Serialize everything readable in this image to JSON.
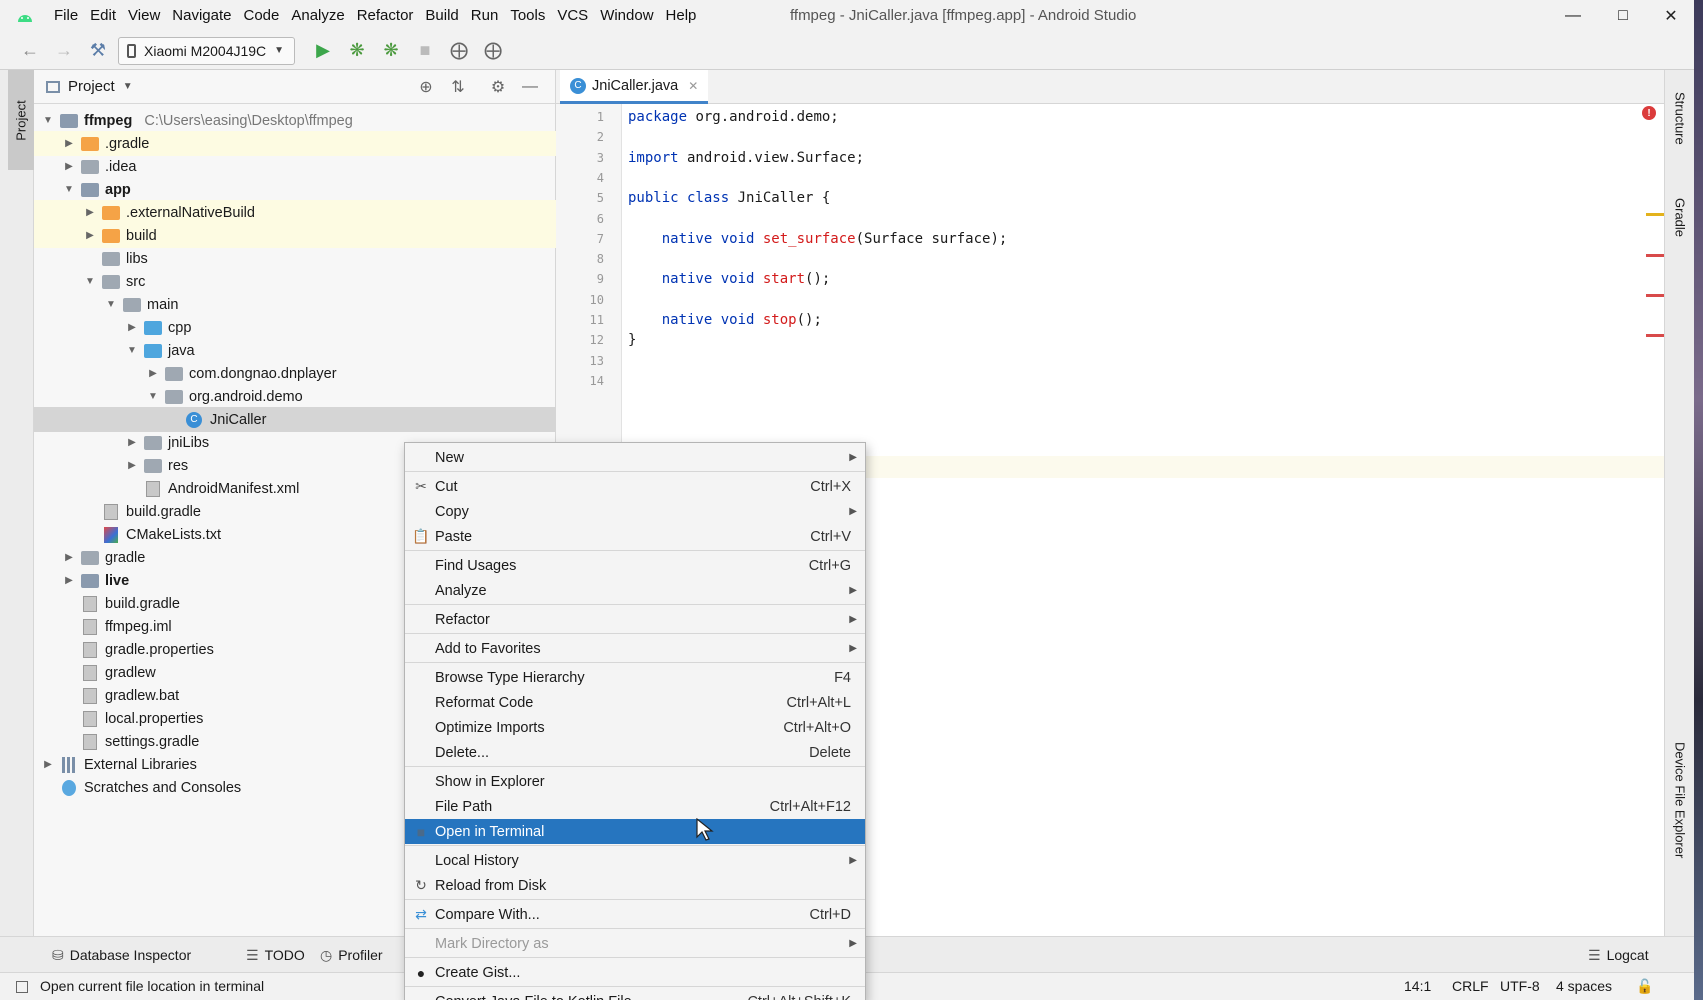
{
  "title_bar": {
    "menus": [
      "File",
      "Edit",
      "View",
      "Navigate",
      "Code",
      "Analyze",
      "Refactor",
      "Build",
      "Run",
      "Tools",
      "VCS",
      "Window",
      "Help"
    ],
    "window_title": "ffmpeg - JniCaller.java [ffmpeg.app] - Android Studio"
  },
  "toolbar": {
    "device": "Xiaomi M2004J19C"
  },
  "project_panel": {
    "header": "Project",
    "tab_label": "Project",
    "root_path": "C:\\Users\\easing\\Desktop\\ffmpeg",
    "tree": [
      {
        "label": "ffmpeg",
        "level": 0,
        "arrow": "down",
        "icon": "module",
        "bold": true
      },
      {
        "label": ".gradle",
        "level": 1,
        "arrow": "right",
        "icon": "folder-orange",
        "highlight": true
      },
      {
        "label": ".idea",
        "level": 1,
        "arrow": "right",
        "icon": "folder-gray"
      },
      {
        "label": "app",
        "level": 1,
        "arrow": "down",
        "icon": "module",
        "bold": true
      },
      {
        "label": ".externalNativeBuild",
        "level": 2,
        "arrow": "right",
        "icon": "folder-orange",
        "highlight": true
      },
      {
        "label": "build",
        "level": 2,
        "arrow": "right",
        "icon": "folder-orange",
        "highlight": true
      },
      {
        "label": "libs",
        "level": 2,
        "arrow": "",
        "icon": "folder-gray"
      },
      {
        "label": "src",
        "level": 2,
        "arrow": "down",
        "icon": "folder-gray"
      },
      {
        "label": "main",
        "level": 3,
        "arrow": "down",
        "icon": "folder-gray"
      },
      {
        "label": "cpp",
        "level": 4,
        "arrow": "right",
        "icon": "folder-blue"
      },
      {
        "label": "java",
        "level": 4,
        "arrow": "down",
        "icon": "folder-blue"
      },
      {
        "label": "com.dongnao.dnplayer",
        "level": 5,
        "arrow": "right",
        "icon": "folder-pkg"
      },
      {
        "label": "org.android.demo",
        "level": 5,
        "arrow": "down",
        "icon": "folder-pkg"
      },
      {
        "label": "JniCaller",
        "level": 6,
        "arrow": "",
        "icon": "class",
        "selected": true
      },
      {
        "label": "jniLibs",
        "level": 4,
        "arrow": "right",
        "icon": "folder-gray"
      },
      {
        "label": "res",
        "level": 4,
        "arrow": "right",
        "icon": "folder-gray"
      },
      {
        "label": "AndroidManifest.xml",
        "level": 4,
        "arrow": "",
        "icon": "file"
      },
      {
        "label": "build.gradle",
        "level": 2,
        "arrow": "",
        "icon": "file"
      },
      {
        "label": "CMakeLists.txt",
        "level": 2,
        "arrow": "",
        "icon": "cmake"
      },
      {
        "label": "gradle",
        "level": 1,
        "arrow": "right",
        "icon": "folder-gray"
      },
      {
        "label": "live",
        "level": 1,
        "arrow": "right",
        "icon": "module",
        "bold": true
      },
      {
        "label": "build.gradle",
        "level": 1,
        "arrow": "",
        "icon": "file"
      },
      {
        "label": "ffmpeg.iml",
        "level": 1,
        "arrow": "",
        "icon": "file"
      },
      {
        "label": "gradle.properties",
        "level": 1,
        "arrow": "",
        "icon": "file"
      },
      {
        "label": "gradlew",
        "level": 1,
        "arrow": "",
        "icon": "file"
      },
      {
        "label": "gradlew.bat",
        "level": 1,
        "arrow": "",
        "icon": "file"
      },
      {
        "label": "local.properties",
        "level": 1,
        "arrow": "",
        "icon": "file"
      },
      {
        "label": "settings.gradle",
        "level": 1,
        "arrow": "",
        "icon": "file"
      },
      {
        "label": "External Libraries",
        "level": 0,
        "arrow": "right",
        "icon": "library"
      },
      {
        "label": "Scratches and Consoles",
        "level": 0,
        "arrow": "",
        "icon": "scratch"
      }
    ]
  },
  "editor": {
    "tab": "JniCaller.java",
    "lines": [
      {
        "n": "1",
        "parts": [
          {
            "t": "package",
            "c": "kw"
          },
          {
            "t": " org.android.demo;"
          }
        ]
      },
      {
        "n": "2",
        "parts": []
      },
      {
        "n": "3",
        "parts": [
          {
            "t": "import",
            "c": "kw"
          },
          {
            "t": " android.view.Surface;"
          }
        ]
      },
      {
        "n": "4",
        "parts": []
      },
      {
        "n": "5",
        "parts": [
          {
            "t": "public class",
            "c": "kw"
          },
          {
            "t": " JniCaller {"
          }
        ]
      },
      {
        "n": "6",
        "parts": []
      },
      {
        "n": "7",
        "parts": [
          {
            "t": "    "
          },
          {
            "t": "native void",
            "c": "kw"
          },
          {
            "t": " "
          },
          {
            "t": "set_surface",
            "c": "fn"
          },
          {
            "t": "(Surface surface);"
          }
        ]
      },
      {
        "n": "8",
        "parts": []
      },
      {
        "n": "9",
        "parts": [
          {
            "t": "    "
          },
          {
            "t": "native void",
            "c": "kw"
          },
          {
            "t": " "
          },
          {
            "t": "start",
            "c": "fn"
          },
          {
            "t": "();"
          }
        ]
      },
      {
        "n": "10",
        "parts": []
      },
      {
        "n": "11",
        "parts": [
          {
            "t": "    "
          },
          {
            "t": "native void",
            "c": "kw"
          },
          {
            "t": " "
          },
          {
            "t": "stop",
            "c": "fn"
          },
          {
            "t": "();"
          }
        ]
      },
      {
        "n": "12",
        "parts": [
          {
            "t": "}"
          }
        ]
      },
      {
        "n": "13",
        "parts": []
      },
      {
        "n": "14",
        "parts": []
      }
    ]
  },
  "right_tabs": [
    "Structure",
    "Gradle",
    "Device File Explorer"
  ],
  "context_menu": {
    "items": [
      {
        "label": "New",
        "shortcut": "",
        "submenu": true,
        "icon": ""
      },
      {
        "sep": true
      },
      {
        "label": "Cut",
        "shortcut": "Ctrl+X",
        "icon": "cut-icon"
      },
      {
        "label": "Copy",
        "shortcut": "",
        "submenu": true,
        "icon": ""
      },
      {
        "label": "Paste",
        "shortcut": "Ctrl+V",
        "icon": "paste-icon"
      },
      {
        "sep": true
      },
      {
        "label": "Find Usages",
        "shortcut": "Ctrl+G",
        "icon": ""
      },
      {
        "label": "Analyze",
        "shortcut": "",
        "submenu": true,
        "icon": ""
      },
      {
        "sep": true
      },
      {
        "label": "Refactor",
        "shortcut": "",
        "submenu": true,
        "icon": ""
      },
      {
        "sep": true
      },
      {
        "label": "Add to Favorites",
        "shortcut": "",
        "submenu": true,
        "icon": ""
      },
      {
        "sep": true
      },
      {
        "label": "Browse Type Hierarchy",
        "shortcut": "F4",
        "icon": ""
      },
      {
        "label": "Reformat Code",
        "shortcut": "Ctrl+Alt+L",
        "icon": ""
      },
      {
        "label": "Optimize Imports",
        "shortcut": "Ctrl+Alt+O",
        "icon": ""
      },
      {
        "label": "Delete...",
        "shortcut": "Delete",
        "icon": ""
      },
      {
        "sep": true
      },
      {
        "label": "Show in Explorer",
        "shortcut": "",
        "icon": ""
      },
      {
        "label": "File Path",
        "shortcut": "Ctrl+Alt+F12",
        "icon": ""
      },
      {
        "label": "Open in Terminal",
        "shortcut": "",
        "icon": "terminal-icon",
        "active": true
      },
      {
        "sep": true
      },
      {
        "label": "Local History",
        "shortcut": "",
        "submenu": true,
        "icon": ""
      },
      {
        "label": "Reload from Disk",
        "shortcut": "",
        "icon": "reload-icon"
      },
      {
        "sep": true
      },
      {
        "label": "Compare With...",
        "shortcut": "Ctrl+D",
        "icon": "compare-icon"
      },
      {
        "sep": true
      },
      {
        "label": "Mark Directory as",
        "shortcut": "",
        "submenu": true,
        "disabled": true,
        "icon": ""
      },
      {
        "sep": true
      },
      {
        "label": "Create Gist...",
        "shortcut": "",
        "icon": "github-icon"
      },
      {
        "sep": true
      },
      {
        "label": "Convert Java File to Kotlin File",
        "shortcut": "Ctrl+Alt+Shift+K",
        "icon": ""
      }
    ]
  },
  "bottom_tabs": [
    "Database Inspector",
    "TODO",
    "Profiler",
    "Logcat"
  ],
  "status_bar": {
    "message": "Open current file location in terminal",
    "position": "14:1",
    "line_sep": "CRLF",
    "encoding": "UTF-8",
    "indent": "4 spaces"
  },
  "colors": {
    "accent": "#2675bf",
    "keyword": "#0033b3",
    "method": "#d31b1b",
    "excluded_folder": "#f5a346",
    "source_folder": "#4ea6de"
  }
}
